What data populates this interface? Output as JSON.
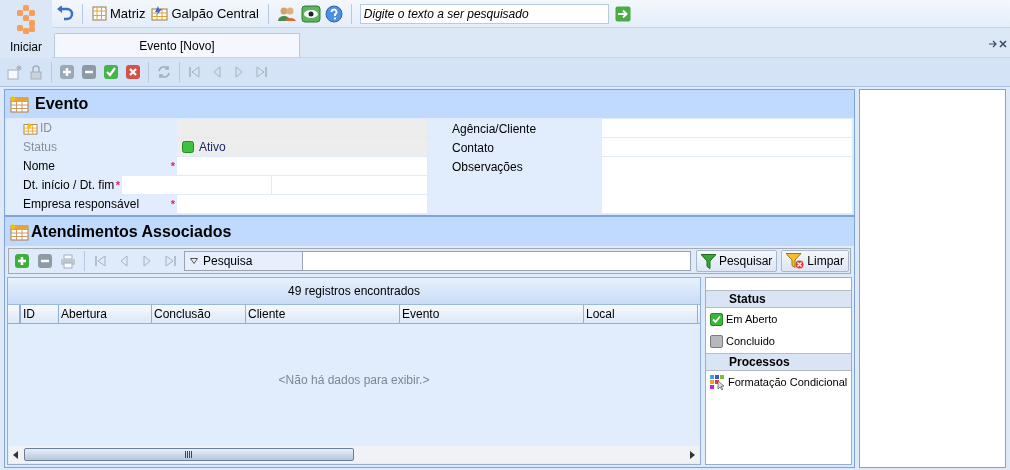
{
  "top_bar": {
    "start_label": "Iniciar",
    "branches": [
      "Matriz",
      "Galpão Central"
    ],
    "search": {
      "placeholder": "Digite o texto a ser pesquisado"
    }
  },
  "tabs": [
    {
      "label": "Evento [Novo]",
      "selected": true
    }
  ],
  "record_toolbar": [
    {
      "kind": "new",
      "disabled": true
    },
    {
      "kind": "lock",
      "disabled": true
    },
    {
      "kind": "add",
      "disabled": true
    },
    {
      "kind": "remove",
      "disabled": true
    },
    {
      "kind": "confirm",
      "disabled": false
    },
    {
      "kind": "cancel",
      "disabled": false
    },
    {
      "kind": "refresh",
      "disabled": true
    },
    {
      "kind": "first",
      "disabled": true
    },
    {
      "kind": "prev",
      "disabled": true
    },
    {
      "kind": "next",
      "disabled": true
    },
    {
      "kind": "last",
      "disabled": true
    }
  ],
  "form": {
    "title": "Evento",
    "left_fields": [
      {
        "label": "ID",
        "kind": "id",
        "disabled": true
      },
      {
        "label": "Status",
        "kind": "status",
        "disabled": true,
        "value": "Ativo"
      },
      {
        "label": "Nome",
        "kind": "text",
        "disabled": false,
        "marker": "*"
      },
      {
        "label": "Dt. início  / Dt. fim",
        "kind": "range",
        "disabled": false,
        "marker": "*"
      },
      {
        "label": "Empresa responsável",
        "kind": "text",
        "disabled": false,
        "marker": "*"
      }
    ],
    "right_fields": [
      {
        "label": "Agência/Cliente",
        "kind": "text"
      },
      {
        "label": "Contato",
        "kind": "text"
      },
      {
        "label": "Observações",
        "kind": "memo"
      }
    ]
  },
  "attendances": {
    "title": "Atendimentos Associados",
    "toolbar": [
      {
        "kind": "add",
        "disabled": false
      },
      {
        "kind": "remove",
        "disabled": true
      },
      {
        "kind": "print",
        "disabled": true
      },
      {
        "kind": "first",
        "disabled": true
      },
      {
        "kind": "prev",
        "disabled": true
      },
      {
        "kind": "next",
        "disabled": true
      },
      {
        "kind": "last",
        "disabled": true
      }
    ],
    "search_scope": "Pesquisa",
    "search_button": "Pesquisar",
    "clear_button": "Limpar",
    "count": "49 registros encontrados",
    "columns": [
      "ID",
      "Abertura",
      "Conclusão",
      "Cliente",
      "Evento",
      "Local"
    ],
    "empty_text": "<Não há dados para exibir.>",
    "side_sections": [
      {
        "title": "Status",
        "items": [
          {
            "label": "Em Aberto",
            "kind": "check",
            "checked": true
          },
          {
            "label": "Concluido",
            "kind": "check",
            "checked": false
          }
        ]
      },
      {
        "title": "Processos",
        "items": [
          {
            "label": "Formatação Condicional",
            "kind": "action"
          }
        ]
      }
    ]
  }
}
